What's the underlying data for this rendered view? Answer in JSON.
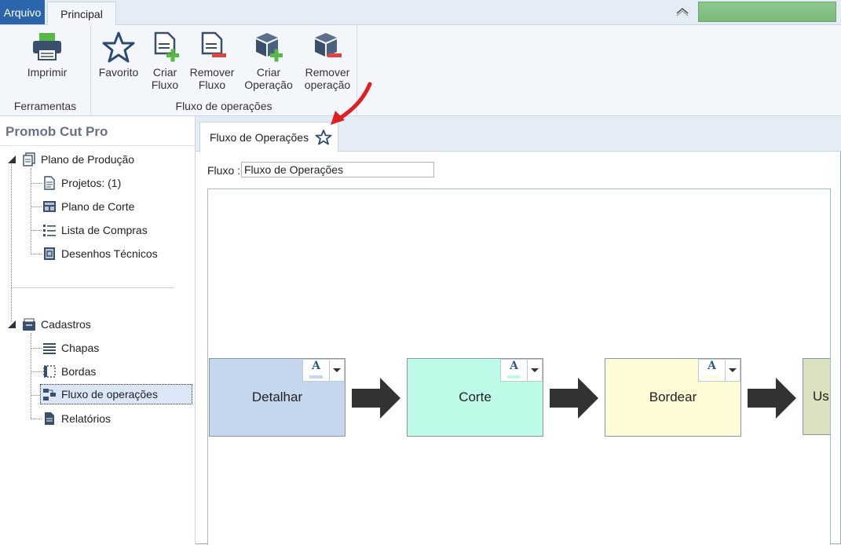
{
  "tabs": {
    "file": "Arquivo",
    "main": "Principal"
  },
  "ribbon": {
    "groups": [
      {
        "label": "Ferramentas",
        "buttons": [
          {
            "line1": "Imprimir",
            "line2": "",
            "icon": "printer-icon"
          }
        ]
      },
      {
        "label": "Fluxo de operações",
        "buttons": [
          {
            "line1": "Favorito",
            "line2": "",
            "icon": "star-icon"
          },
          {
            "line1": "Criar",
            "line2": "Fluxo",
            "icon": "create-flow-icon"
          },
          {
            "line1": "Remover",
            "line2": "Fluxo",
            "icon": "remove-flow-icon"
          },
          {
            "line1": "Criar",
            "line2": "Operação",
            "icon": "create-operation-icon"
          },
          {
            "line1": "Remover",
            "line2": "operação",
            "icon": "remove-operation-icon"
          }
        ]
      }
    ]
  },
  "sidebar": {
    "title": "Promob Cut Pro",
    "plano": {
      "label": "Plano de Produção",
      "children": [
        "Projetos: (1)",
        "Plano de Corte",
        "Lista de Compras",
        "Desenhos Técnicos"
      ]
    },
    "cadastros": {
      "label": "Cadastros",
      "children": [
        "Chapas",
        "Bordas",
        "Fluxo de operações",
        "Relatórios"
      ]
    }
  },
  "document": {
    "tab_label": "Fluxo de Operações",
    "fluxo_label": "Fluxo :",
    "fluxo_value": "Fluxo de Operações",
    "format_glyph": "A",
    "operations": [
      {
        "name": "Detalhar",
        "color": "#c5d7ee"
      },
      {
        "name": "Corte",
        "color": "#bdfbe8"
      },
      {
        "name": "Bordear",
        "color": "#fdfcd6"
      },
      {
        "name": "Us",
        "color": "#d9e2bc"
      }
    ]
  },
  "colors": {
    "accent": "#2b66ad",
    "annotation": "#e02020"
  }
}
